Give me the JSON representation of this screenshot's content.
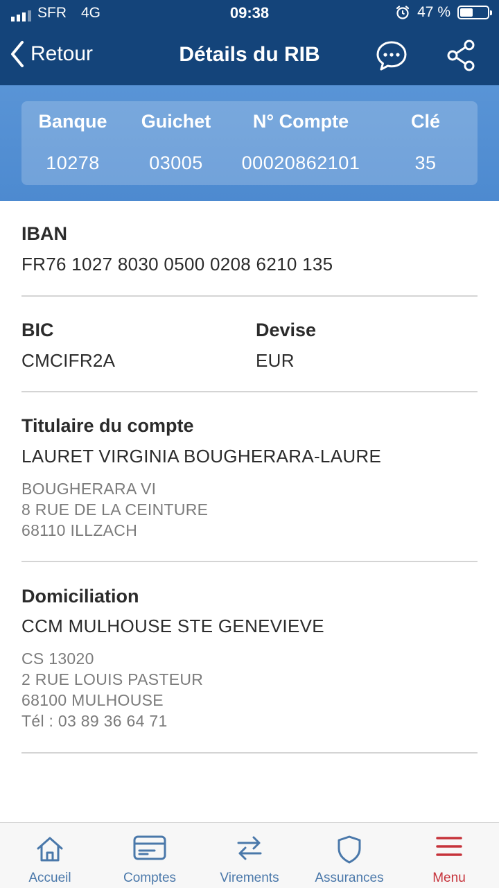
{
  "status_bar": {
    "carrier": "SFR",
    "network": "4G",
    "time": "09:38",
    "battery": "47 %",
    "battery_level": 0.47
  },
  "nav": {
    "back_label": "Retour",
    "title": "Détails du RIB"
  },
  "rib": {
    "columns": [
      {
        "header": "Banque",
        "value": "10278"
      },
      {
        "header": "Guichet",
        "value": "03005"
      },
      {
        "header": "N° Compte",
        "value": "00020862101"
      },
      {
        "header": "Clé",
        "value": "35"
      }
    ]
  },
  "iban": {
    "label": "IBAN",
    "value": "FR76 1027 8030 0500 0208 6210 135"
  },
  "bic": {
    "label": "BIC",
    "value": "CMCIFR2A"
  },
  "devise": {
    "label": "Devise",
    "value": "EUR"
  },
  "titulaire": {
    "label": "Titulaire du compte",
    "name": "LAURET VIRGINIA BOUGHERARA-LAURE",
    "address": [
      "BOUGHERARA VI",
      "8 RUE DE LA CEINTURE",
      "68110 ILLZACH"
    ]
  },
  "domiciliation": {
    "label": "Domiciliation",
    "name": "CCM MULHOUSE STE GENEVIEVE",
    "address": [
      "CS 13020",
      "2 RUE LOUIS PASTEUR",
      "68100 MULHOUSE",
      "Tél : 03 89 36 64 71"
    ]
  },
  "tabs": [
    {
      "label": "Accueil",
      "icon": "home-icon"
    },
    {
      "label": "Comptes",
      "icon": "card-icon"
    },
    {
      "label": "Virements",
      "icon": "transfer-icon"
    },
    {
      "label": "Assurances",
      "icon": "shield-icon"
    },
    {
      "label": "Menu",
      "icon": "menu-icon",
      "active": true
    }
  ],
  "colors": {
    "nav_bg": "#14447a",
    "band_bg": "#5994d6",
    "tab_blue": "#4a78aa",
    "tab_active": "#c6323a"
  }
}
